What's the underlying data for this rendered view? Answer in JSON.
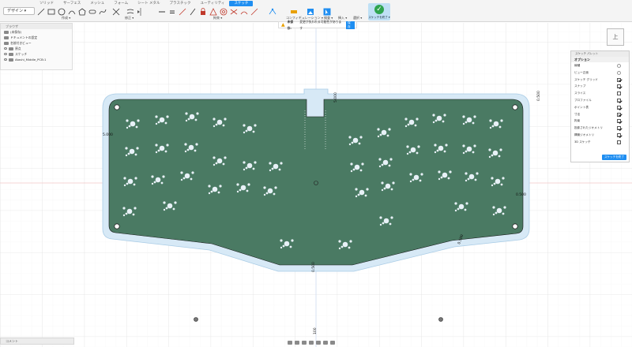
{
  "toolbar": {
    "tabs": [
      "ソリッド",
      "サーフェス",
      "メッシュ",
      "フォーム",
      "シート メタル",
      "プラスチック",
      "ユーティリティ",
      "スケッチ"
    ],
    "design_label": "デザイン ▾",
    "group_create": "作成 ▾",
    "group_modify": "修正 ▾",
    "group_constraints": "拘束 ▾",
    "group_configure": "コンフィギュレーション ▾",
    "group_inspect": "検査 ▾",
    "group_insert": "挿入 ▾",
    "group_select": "選択 ▾",
    "finish_label": "スケッチを終了 ▾"
  },
  "browser": {
    "title": "ブラウザ",
    "items": [
      {
        "label": "(未保存)"
      },
      {
        "label": "ドキュメントの設定"
      },
      {
        "label": "名前付きビュー"
      },
      {
        "label": "原点"
      },
      {
        "label": "スケッチ"
      },
      {
        "label": "Atashi_Middle_PCB:1"
      }
    ]
  },
  "comments_label": "コメント",
  "warning": {
    "prefix": "未保存:",
    "message": "変更が失われる可能性があります",
    "button": "保存"
  },
  "viewcube_label": "上",
  "palette": {
    "title": "スケッチ パレット",
    "section": "オプション",
    "rows": [
      {
        "label": "線種",
        "checked": null
      },
      {
        "label": "ビュー正面",
        "checked": null
      },
      {
        "label": "スケッチ グリッド",
        "checked": true
      },
      {
        "label": "スナップ",
        "checked": true
      },
      {
        "label": "スライス",
        "checked": false
      },
      {
        "label": "プロファイル",
        "checked": true
      },
      {
        "label": "ポイント表",
        "checked": true
      },
      {
        "label": "寸法",
        "checked": true
      },
      {
        "label": "拘束",
        "checked": true
      },
      {
        "label": "投影されたジオメトリ",
        "checked": true
      },
      {
        "label": "構築ジオメトリ",
        "checked": true
      },
      {
        "label": "3D スケッチ",
        "checked": false
      }
    ],
    "finish_button": "スケッチを終了"
  },
  "dimensions": {
    "left": "5.000",
    "right": "0.500",
    "right_top": "0.500",
    "bottom_a": "0.500",
    "bottom_b": "0.500",
    "top_a": "5.000",
    "top_b": "100"
  },
  "colors": {
    "pcb": "#4a7a63",
    "outline": "#c9e1f2",
    "accent": "#1f8ef1"
  }
}
